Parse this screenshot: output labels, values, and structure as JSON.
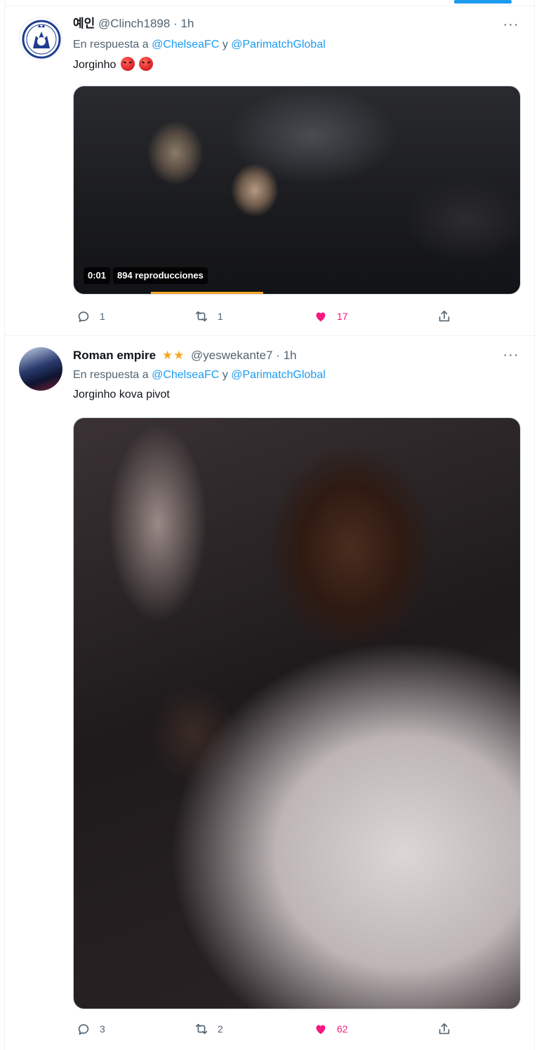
{
  "tweets": [
    {
      "display_name": "예인",
      "badge": "",
      "handle": "@Clinch1898",
      "separator": "·",
      "time": "1h",
      "reply_prefix": "En respuesta a",
      "mentions": [
        "@ChelseaFC",
        "@ParimatchGlobal"
      ],
      "mention_joiner": "y",
      "text": "Jorginho",
      "emoji": [
        "angry-face-icon",
        "swearing-face-icon"
      ],
      "media": {
        "type": "video",
        "time_label": "0:01",
        "views_label": "894 reproducciones"
      },
      "actions": {
        "reply": "1",
        "retweet": "1",
        "like": "17",
        "share": ""
      },
      "like_color": "#f91880"
    },
    {
      "display_name": "Roman empire",
      "badge": "★★",
      "handle": "@yeswekante7",
      "separator": "·",
      "time": "1h",
      "reply_prefix": "En respuesta a",
      "mentions": [
        "@ChelseaFC",
        "@ParimatchGlobal"
      ],
      "mention_joiner": "y",
      "text": "Jorginho kova pivot",
      "media": {
        "type": "image"
      },
      "actions": {
        "reply": "3",
        "retweet": "2",
        "like": "62",
        "share": ""
      },
      "like_color": "#f91880"
    }
  ],
  "more_menu_glyph": "···",
  "colors": {
    "accent": "#1d9bf0",
    "muted": "#536471",
    "like": "#f91880",
    "star": "#f5a623"
  }
}
